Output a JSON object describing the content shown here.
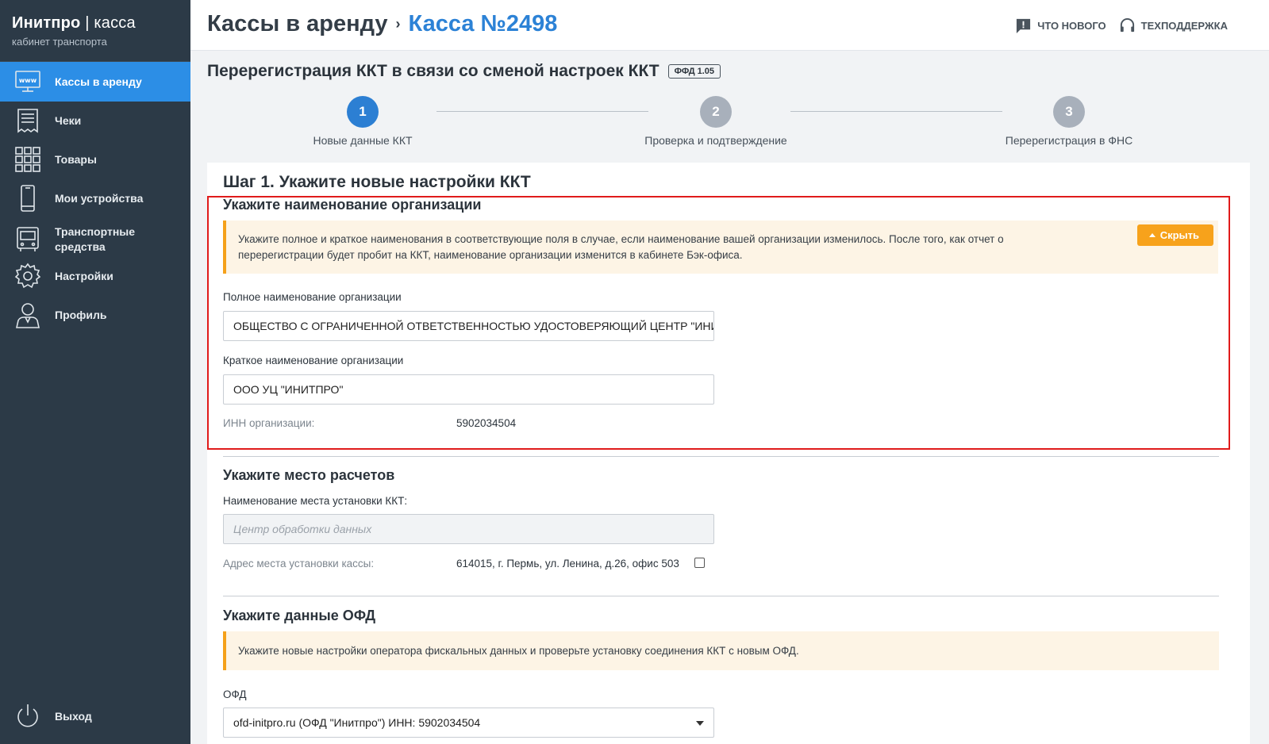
{
  "brand": {
    "name_bold": "Инитпро",
    "separator": " | ",
    "name_thin": "касса",
    "subtitle": "кабинет транспорта"
  },
  "sidebar": {
    "items": [
      {
        "label": "Кассы в аренду",
        "icon": "www-monitor-icon",
        "active": true
      },
      {
        "label": "Чеки",
        "icon": "receipt-icon",
        "active": false
      },
      {
        "label": "Товары",
        "icon": "grid-icon",
        "active": false
      },
      {
        "label": "Мои устройства",
        "icon": "phone-icon",
        "active": false
      },
      {
        "label": "Транспортные средства",
        "icon": "bus-icon",
        "active": false
      },
      {
        "label": "Настройки",
        "icon": "gear-icon",
        "active": false
      },
      {
        "label": "Профиль",
        "icon": "user-icon",
        "active": false
      }
    ],
    "logout": {
      "label": "Выход",
      "icon": "power-icon"
    }
  },
  "header": {
    "crumb1": "Кассы в аренду",
    "crumb_sep": "›",
    "crumb2": "Касса №2498",
    "whats_new": "ЧТО НОВОГО",
    "support": "ТЕХПОДДЕРЖКА"
  },
  "page": {
    "title": "Перерегистрация ККТ в связи со сменой настроек ККТ",
    "badge": "ФФД 1.05"
  },
  "stepper": {
    "steps": [
      {
        "num": "1",
        "label": "Новые данные ККТ",
        "active": true
      },
      {
        "num": "2",
        "label": "Проверка и подтверждение",
        "active": false
      },
      {
        "num": "3",
        "label": "Перерегистрация в ФНС",
        "active": false
      }
    ]
  },
  "form": {
    "step_heading": "Шаг 1. Укажите новые настройки ККТ",
    "org": {
      "title": "Укажите наименование организации",
      "notice": "Укажите полное и краткое наименования в соответствующие поля в случае, если наименование вашей организации изменилось. После того, как отчет о перерегистрации будет пробит на ККТ, наименование организации изменится в кабинете Бэк-офиса.",
      "hide_label": "Скрыть",
      "full_label": "Полное наименование организации",
      "full_value": "ОБЩЕСТВО С ОГРАНИЧЕННОЙ ОТВЕТСТВЕННОСТЬЮ УДОСТОВЕРЯЮЩИЙ ЦЕНТР \"ИНИТПРО\"",
      "short_label": "Краткое наименование организации",
      "short_value": "ООО УЦ \"ИНИТПРО\"",
      "inn_label": "ИНН организации:",
      "inn_value": "5902034504"
    },
    "place": {
      "title": "Укажите место расчетов",
      "place_label": "Наименование места установки ККТ:",
      "place_placeholder": "Центр обработки данных",
      "address_label": "Адрес места установки кассы:",
      "address_value": "614015, г. Пермь, ул. Ленина, д.26, офис 503"
    },
    "ofd": {
      "title": "Укажите данные ОФД",
      "notice": "Укажите новые настройки оператора фискальных данных и проверьте установку соединения ККТ с новым ОФД.",
      "ofd_label": "ОФД",
      "ofd_value": "ofd-initpro.ru (ОФД \"Инитпро\") ИНН: 5902034504"
    }
  },
  "colors": {
    "sidebar_bg": "#2c3a47",
    "accent": "#2c8ee6",
    "orange": "#f7a21b",
    "highlight_red": "#e01b1b"
  }
}
